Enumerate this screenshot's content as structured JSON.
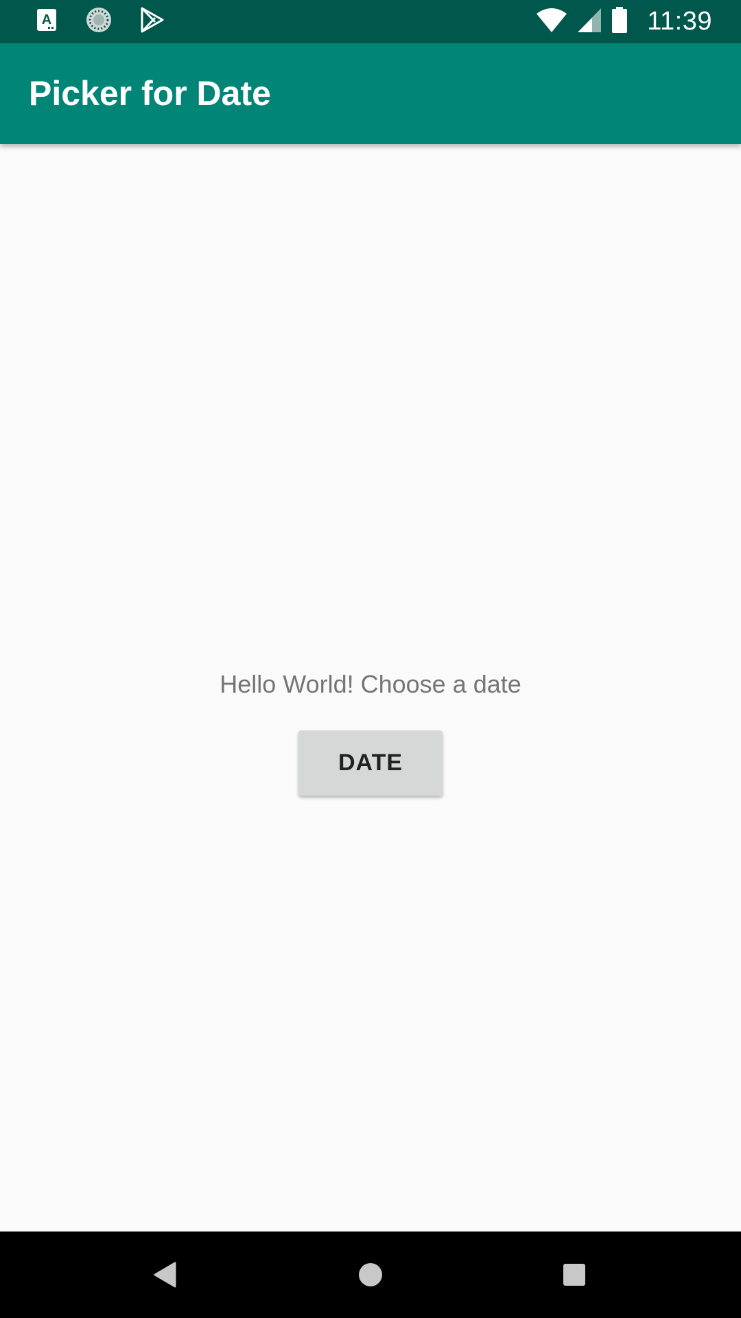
{
  "status_bar": {
    "time": "11:39",
    "left_icons": [
      "a-keyboard-icon",
      "loading-icon",
      "play-store-icon"
    ],
    "right_icons": [
      "wifi-icon",
      "signal-icon",
      "battery-icon"
    ]
  },
  "app_bar": {
    "title": "Picker for Date"
  },
  "main": {
    "greeting": "Hello World! Choose a date",
    "date_button_label": "DATE"
  },
  "nav_bar": {
    "icons": [
      "back-icon",
      "home-icon",
      "recents-icon"
    ]
  },
  "colors": {
    "status_bar": "#00574b",
    "app_bar": "#008577",
    "background": "#fafafa",
    "button": "#d6d7d7"
  }
}
